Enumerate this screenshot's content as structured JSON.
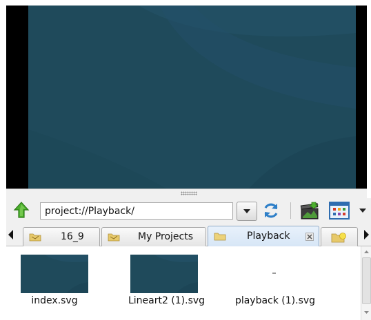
{
  "toolbar": {
    "path_value": "project://Playback/",
    "icons": {
      "up": "up-arrow-icon",
      "dropdown": "chevron-down-icon",
      "refresh": "refresh-icon",
      "import": "import-media-icon",
      "view": "view-mode-icon",
      "view_menu": "chevron-down-icon"
    }
  },
  "tabs": [
    {
      "label": "16_9",
      "icon": "folder-icon"
    },
    {
      "label": "My Projects",
      "icon": "folder-icon"
    },
    {
      "label": "Playback",
      "icon": "folder-icon",
      "active": true
    }
  ],
  "files": [
    {
      "name": "index.svg",
      "thumbnail": true
    },
    {
      "name": "Lineart2 (1).svg",
      "thumbnail": true
    },
    {
      "name": "playback (1).svg",
      "thumbnail": false
    }
  ],
  "colors": {
    "preview_bg": "#1f4a5b",
    "frame_bg": "#000000",
    "panel_bg": "#f0f0f0",
    "active_tab": "#d7e6f6"
  }
}
